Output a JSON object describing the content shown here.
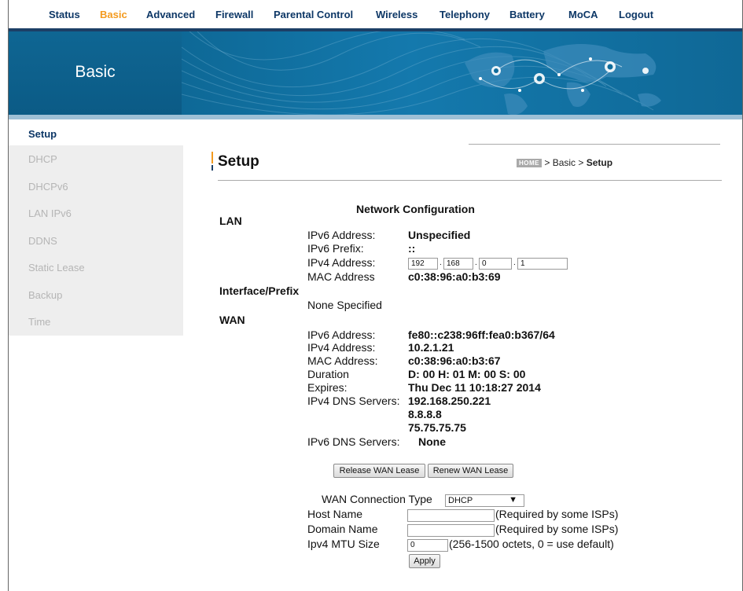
{
  "nav": [
    {
      "label": "Status",
      "active": false
    },
    {
      "label": "Basic",
      "active": true
    },
    {
      "label": "Advanced",
      "active": false
    },
    {
      "label": "Firewall",
      "active": false
    },
    {
      "label": "Parental Control",
      "active": false
    },
    {
      "label": "Wireless",
      "active": false
    },
    {
      "label": "Telephony",
      "active": false
    },
    {
      "label": "Battery",
      "active": false
    },
    {
      "label": "MoCA",
      "active": false
    },
    {
      "label": "Logout",
      "active": false
    }
  ],
  "banner": {
    "title": "Basic"
  },
  "sidebar": {
    "items": [
      "Setup",
      "DHCP",
      "DHCPv6",
      "LAN IPv6",
      "DDNS",
      "Static Lease",
      "Backup",
      "Time"
    ]
  },
  "page": {
    "title": "Setup",
    "breadcrumb": {
      "home": "HOME",
      "sep1": " > ",
      "section": "Basic",
      "sep2": " > ",
      "current": "Setup"
    }
  },
  "network": {
    "heading": "Network Configuration",
    "lan": {
      "heading": "LAN",
      "ipv6_label": "IPv6 Address:",
      "ipv6_value": "Unspecified",
      "prefix_label": "IPv6 Prefix:",
      "prefix_value": "::",
      "ipv4_label": "IPv4 Address:",
      "ipv4_octets": [
        "192",
        "168",
        "0",
        "1"
      ],
      "mac_label": "MAC Address",
      "mac_value": "c0:38:96:a0:b3:69"
    },
    "interface": {
      "heading": "Interface/Prefix",
      "value": "None Specified"
    },
    "wan": {
      "heading": "WAN",
      "ipv6_label": "IPv6 Address:",
      "ipv6_value": "fe80::c238:96ff:fea0:b367/64",
      "ipv4_label": "IPv4 Address:",
      "ipv4_value": "10.2.1.21",
      "mac_label": "MAC Address:",
      "mac_value": "c0:38:96:a0:b3:67",
      "duration_label": "Duration",
      "duration_value": "D: 00 H: 01 M: 00 S: 00",
      "expires_label": "Expires:",
      "expires_value": "Thu Dec 11 10:18:27 2014",
      "dns4_label": "IPv4 DNS Servers:",
      "dns4_values": [
        "192.168.250.221",
        "8.8.8.8",
        "75.75.75.75"
      ],
      "dns6_label": "IPv6 DNS Servers:",
      "dns6_value": "None"
    },
    "buttons": {
      "release": "Release WAN Lease",
      "renew": "Renew WAN Lease"
    },
    "connection": {
      "type_label": "WAN Connection Type",
      "type_value": "DHCP",
      "type_arrow": "▼",
      "host_label": "Host Name",
      "host_value": "",
      "host_hint": "(Required by some ISPs)",
      "domain_label": "Domain Name",
      "domain_value": "",
      "domain_hint": "(Required by some ISPs)",
      "mtu_label": "Ipv4 MTU Size",
      "mtu_value": "0",
      "mtu_hint": "(256-1500 octets, 0 = use default)",
      "apply": "Apply"
    }
  },
  "colors": {
    "nav_text": "#0d3766",
    "nav_active": "#f39a1e",
    "banner": "#0f6c9b",
    "sidebar_bg": "#eeeeee"
  }
}
